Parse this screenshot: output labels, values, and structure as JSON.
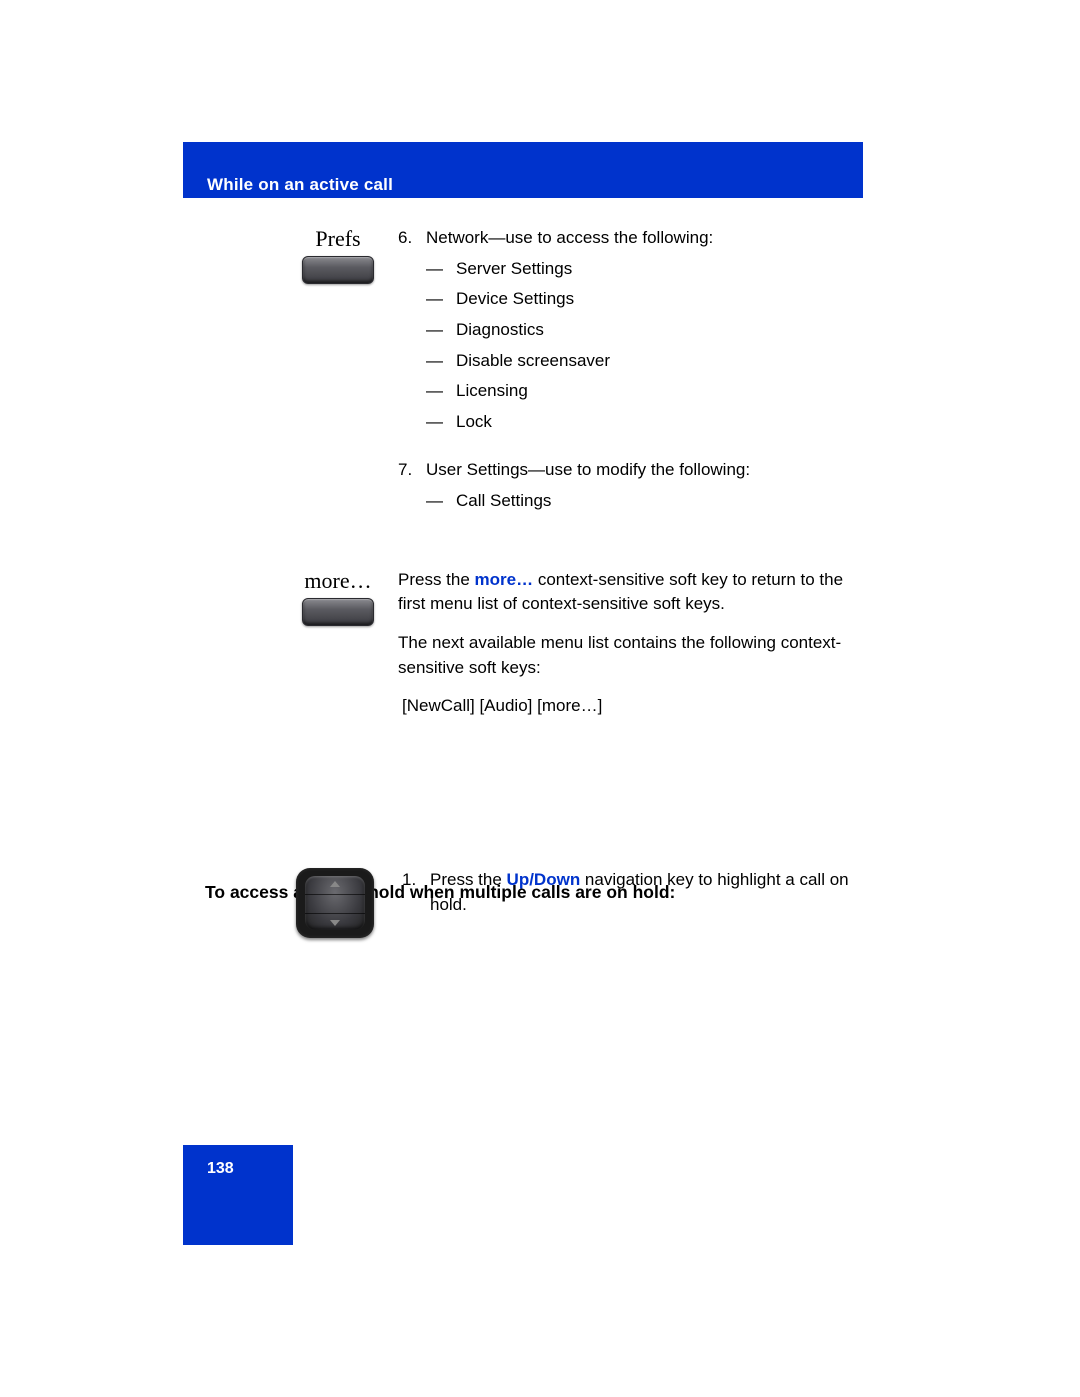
{
  "header": {
    "title": "While on an active call"
  },
  "prefs": {
    "label": "Prefs",
    "item6_num": "6.",
    "item6_text": "Network—use to access the following:",
    "item6_sub": [
      "Server Settings",
      "Device Settings",
      "Diagnostics",
      "Disable screensaver",
      "Licensing",
      "Lock"
    ],
    "item7_num": "7.",
    "item7_text": "User Settings—use to modify the following:",
    "item7_sub": [
      "Call Settings"
    ]
  },
  "more": {
    "label": "more…",
    "para1_pre": "Press the ",
    "para1_link": "more…",
    "para1_post": " context-sensitive soft key to return to the first menu list of context-sensitive soft keys.",
    "para2": "The next available menu list contains the following context-sensitive soft keys:",
    "para3": "[NewCall] [Audio] [more…]"
  },
  "section2": {
    "heading": "To access a call on hold when multiple calls are on hold:",
    "step_num": "1.",
    "step_pre": "Press the ",
    "step_link": "Up/Down",
    "step_post": " navigation key to highlight a call on hold."
  },
  "dash": "—",
  "footer": {
    "page_number": "138"
  }
}
